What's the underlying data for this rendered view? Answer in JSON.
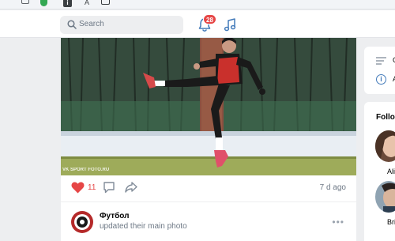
{
  "browser": {
    "info_glyph": "i",
    "a_glyph": "A"
  },
  "header": {
    "search_placeholder": "Search",
    "notifications_count": "28"
  },
  "post": {
    "watermark": "VK SPORT FOTO.RU",
    "likes": "11",
    "time": "7 d ago",
    "update_name": "Футбол",
    "update_text": "updated their main photo",
    "more": "•••"
  },
  "sidebar_menu": {
    "item1_label": "C",
    "item2_glyph": "i",
    "item2_label": "A"
  },
  "follow": {
    "title": "Follow",
    "suggestions": [
      {
        "name": "Ali"
      },
      {
        "name": "Bri"
      }
    ]
  },
  "colors": {
    "accent": "#447bba",
    "like": "#e64646",
    "badge": "#e64646",
    "background": "#edeef0"
  },
  "icons": [
    "window-icon",
    "shield-icon",
    "info-icon",
    "font-icon",
    "tabs-icon",
    "search-icon",
    "bell-icon",
    "music-icon",
    "heart-icon",
    "comment-icon",
    "share-icon",
    "more-icon",
    "menu-lines-icon",
    "info-circle-icon"
  ]
}
